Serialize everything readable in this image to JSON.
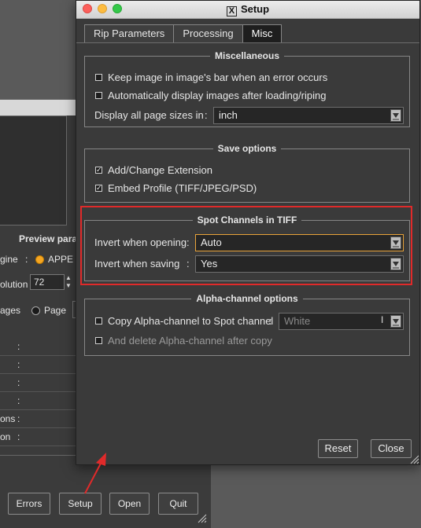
{
  "background_window": {
    "preview_label": "Preview paran",
    "engine_label": "gine",
    "engine_sep": ":",
    "engine_value": "APPE",
    "resolution_label": "olution",
    "resolution_value": "72",
    "pages_label": "ages",
    "page_radio_label": "Page",
    "rows": [
      {
        "label": "",
        "sep": ":"
      },
      {
        "label": "",
        "sep": ":"
      },
      {
        "label": "",
        "sep": ":"
      },
      {
        "label": "",
        "sep": ":"
      },
      {
        "label": "ons",
        "sep": ":"
      },
      {
        "label": "on",
        "sep": ":"
      }
    ],
    "buttons": {
      "errors": "Errors",
      "setup": "Setup",
      "open": "Open",
      "quit": "Quit"
    }
  },
  "dialog": {
    "title": "Setup",
    "title_icon": "X",
    "tabs": [
      {
        "label": "Rip Parameters",
        "active": false
      },
      {
        "label": "Processing",
        "active": false
      },
      {
        "label": "Misc",
        "active": true
      }
    ],
    "misc": {
      "title": "Miscellaneous",
      "keep_image": {
        "label": "Keep image in image's bar when an error occurs",
        "checked": false
      },
      "auto_display": {
        "label": "Automatically display images after loading/riping",
        "checked": false
      },
      "page_sizes_label": "Display all page sizes in",
      "page_sizes_sep": ":",
      "page_sizes_value": "inch"
    },
    "save": {
      "title": "Save options",
      "add_extension": {
        "label": "Add/Change Extension",
        "checked": true
      },
      "embed_profile": {
        "label": "Embed Profile (TIFF/JPEG/PSD)",
        "checked": true
      }
    },
    "spot": {
      "title": "Spot Channels in TIFF",
      "invert_opening_label": "Invert when opening",
      "invert_opening_sep": ":",
      "invert_opening_value": "Auto",
      "invert_saving_label": "Invert when saving",
      "invert_saving_sep": ":",
      "invert_saving_value": "Yes"
    },
    "alpha": {
      "title": "Alpha-channel options",
      "copy_alpha": {
        "label": "Copy Alpha-channel to Spot channel",
        "checked": false
      },
      "copy_alpha_sep": ":",
      "spot_value": "White",
      "delete_alpha": {
        "label": "And delete Alpha-channel after copy",
        "checked": false
      }
    },
    "buttons": {
      "reset": "Reset",
      "close": "Close"
    }
  },
  "colors": {
    "highlight": "#e02a2a",
    "focus": "#e8a33a",
    "dialog_bg": "#3a3a3a"
  }
}
